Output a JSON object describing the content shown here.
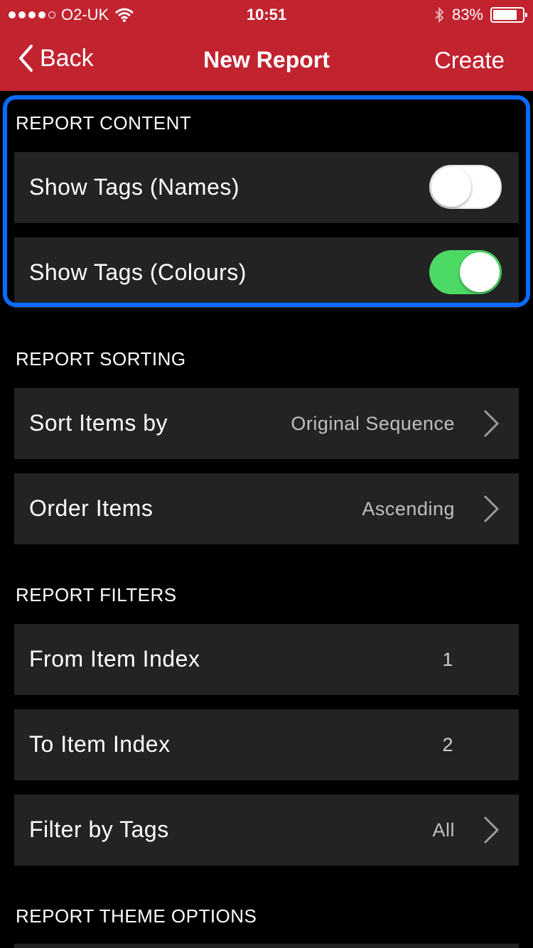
{
  "status_bar": {
    "carrier": "O2-UK",
    "time": "10:51",
    "battery": "83%",
    "battery_level": 0.83,
    "icons": [
      "signal-dots-icon",
      "wifi-icon",
      "bluetooth-icon",
      "battery-icon"
    ]
  },
  "nav": {
    "back_label": "Back",
    "title": "New Report",
    "create_label": "Create"
  },
  "colors": {
    "nav_background": "#c1232f",
    "cell_background": "#232323",
    "toggle_on": "#4cd964",
    "highlight_border": "#0a6cff"
  },
  "sections": {
    "content": {
      "title": "REPORT CONTENT",
      "rows": [
        {
          "label": "Show Tags (Names)",
          "toggle": false
        },
        {
          "label": "Show Tags (Colours)",
          "toggle": true
        }
      ]
    },
    "sorting": {
      "title": "REPORT SORTING",
      "rows": [
        {
          "label": "Sort Items by",
          "value": "Original Sequence"
        },
        {
          "label": "Order Items",
          "value": "Ascending"
        }
      ]
    },
    "filters": {
      "title": "REPORT FILTERS",
      "rows": [
        {
          "label": "From Item Index",
          "value": "1"
        },
        {
          "label": "To Item Index",
          "value": "2"
        },
        {
          "label": "Filter by Tags",
          "value": "All"
        }
      ]
    },
    "theme": {
      "title": "REPORT THEME OPTIONS"
    }
  }
}
